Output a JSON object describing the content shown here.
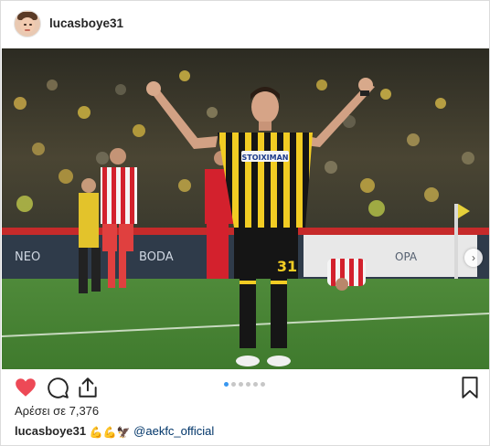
{
  "post": {
    "username": "lucasboye31",
    "likes_text": "Αρέσει σε 7,376",
    "caption_user": "lucasboye31",
    "caption_emojis": [
      "💪",
      "💪",
      "🦅"
    ],
    "caption_mention": "@aekfc_official"
  },
  "photo": {
    "jersey_main_text": "STOIXIMAN",
    "jersey_number": "31",
    "ad_boards": [
      "NEO",
      "BODA",
      "OPA"
    ]
  },
  "carousel": {
    "total": 6,
    "active_index": 0,
    "next_symbol": "›"
  },
  "colors": {
    "like_red": "#ed4956",
    "carousel_active": "#3897f0",
    "aek_yellow": "#f2cc23",
    "olympiacos_red": "#d3212d"
  },
  "icons": [
    "heart-icon",
    "comment-icon",
    "share-icon",
    "bookmark-icon"
  ]
}
